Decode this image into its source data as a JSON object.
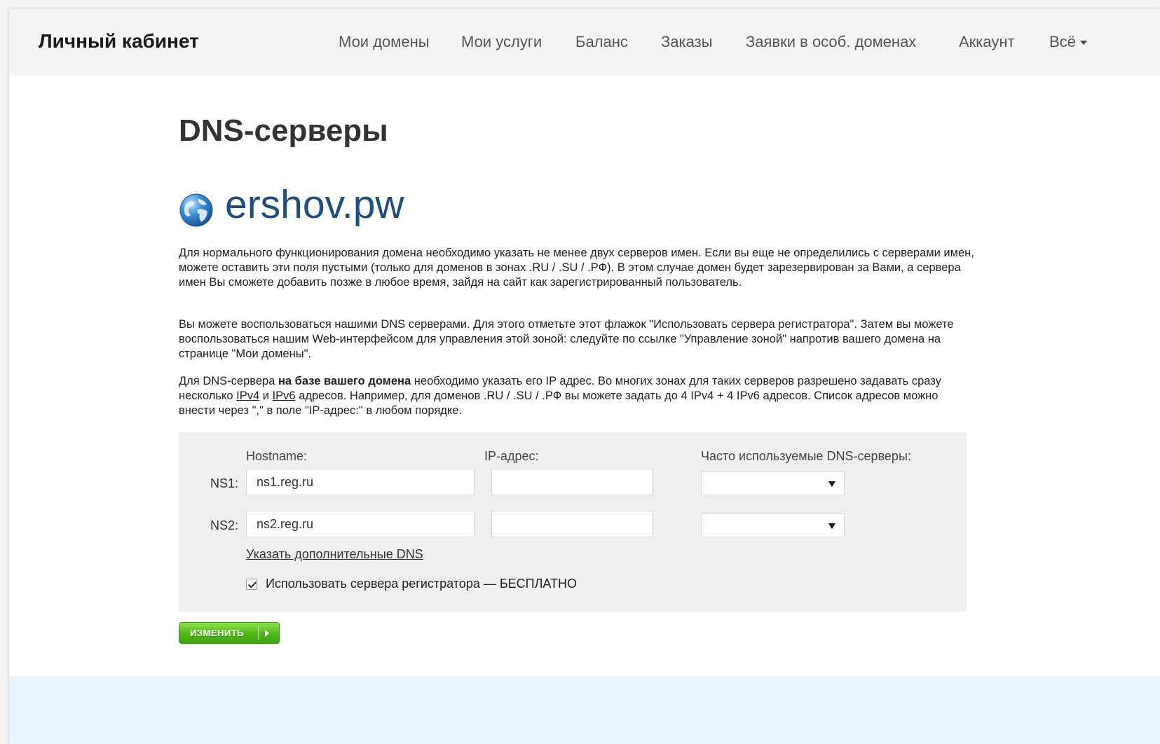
{
  "header": {
    "brand": "Личный кабинет",
    "nav": [
      {
        "label": "Мои домены"
      },
      {
        "label": "Мои услуги"
      },
      {
        "label": "Баланс"
      },
      {
        "label": "Заказы"
      },
      {
        "label": "Заявки в особ. доменах"
      },
      {
        "label": "Аккаунт"
      },
      {
        "label": "Всё"
      }
    ]
  },
  "page": {
    "title": "DNS-серверы",
    "domain": "ershov.pw",
    "globe_icon": "globe-icon",
    "paragraph1": "Для нормального функционирования домена необходимо указать не менее двух серверов имен. Если вы еще не определились с серверами имен, можете оставить эти поля пустыми (только для доменов в зонах .RU / .SU / .РФ). В этом случае домен будет зарезервирован за Вами, а сервера имен Вы сможете добавить позже в любое время, зайдя на сайт как зарегистрированный пользователь.",
    "paragraph2": "Вы можете воспользоваться нашими DNS серверами. Для этого отметьте этот флажок \"Использовать сервера регистратора\". Затем вы можете воспользоваться нашим Web-интерфейсом для управления этой зоной: следуйте по ссылке \"Управление зоной\" напротив вашего домена на странице \"Мои домены\".",
    "paragraph3": {
      "part1": "Для DNS-сервера ",
      "bold": "на базе вашего домена",
      "part2": " необходимо указать его IP адрес. Во многих зонах для таких серверов разрешено задавать сразу несколько ",
      "link_ipv4": "IPv4",
      "and": " и ",
      "link_ipv6": "IPv6",
      "part3": " адресов. Например, для доменов .RU / .SU / .РФ вы можете задать до 4 IPv4 + 4 IPv6 адресов. Список адресов можно внести через \",\" в поле \"IP-адрес:\" в любом порядке."
    }
  },
  "form": {
    "col_hostname": "Hostname:",
    "col_ip": "IP-адрес:",
    "col_popular": "Часто используемые DNS-серверы:",
    "rows": [
      {
        "label": "NS1:",
        "hostname": "ns1.reg.ru",
        "ip": "",
        "popular": ""
      },
      {
        "label": "NS2:",
        "hostname": "ns2.reg.ru",
        "ip": "",
        "popular": ""
      }
    ],
    "add_dns_link": "Указать дополнительные DNS",
    "use_registrar_checked": true,
    "use_registrar_label": "Использовать сервера регистратора — БЕСПЛАТНО",
    "submit_label": "ИЗМЕНИТЬ"
  },
  "colors": {
    "domain": "#1f4f82",
    "submit_green": "#4fb718",
    "footer_band": "#e8f3fb"
  }
}
